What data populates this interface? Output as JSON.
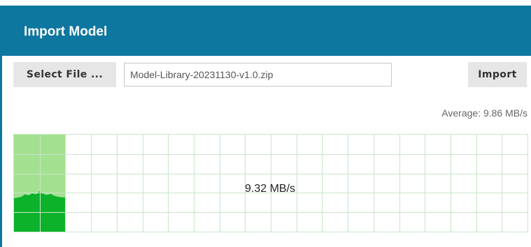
{
  "dialog": {
    "title": "Import Model"
  },
  "toolbar": {
    "select_file_label": "Select File ...",
    "file_name_value": "Model-Library-20231130-v1.0.zip",
    "import_label": "Import"
  },
  "stats": {
    "average_text": "Average: 9.86 MB/s"
  },
  "graph": {
    "current_speed_text": "9.32 MB/s",
    "grid": true,
    "colors": {
      "grid_line": "#c9e5c9",
      "progress_fill": "#a3e090",
      "speed_fill": "#0cb22a"
    },
    "progress_fraction": 0.1,
    "speed_history": [
      6.9,
      7.0,
      7.2,
      7.7,
      7.5,
      7.9,
      7.7,
      8.3,
      7.8,
      7.6,
      7.8,
      7.4,
      7.2,
      7.1,
      7.0
    ]
  },
  "theme": {
    "header_color": "#0e77a0",
    "button_bg": "#e6e6e6"
  }
}
